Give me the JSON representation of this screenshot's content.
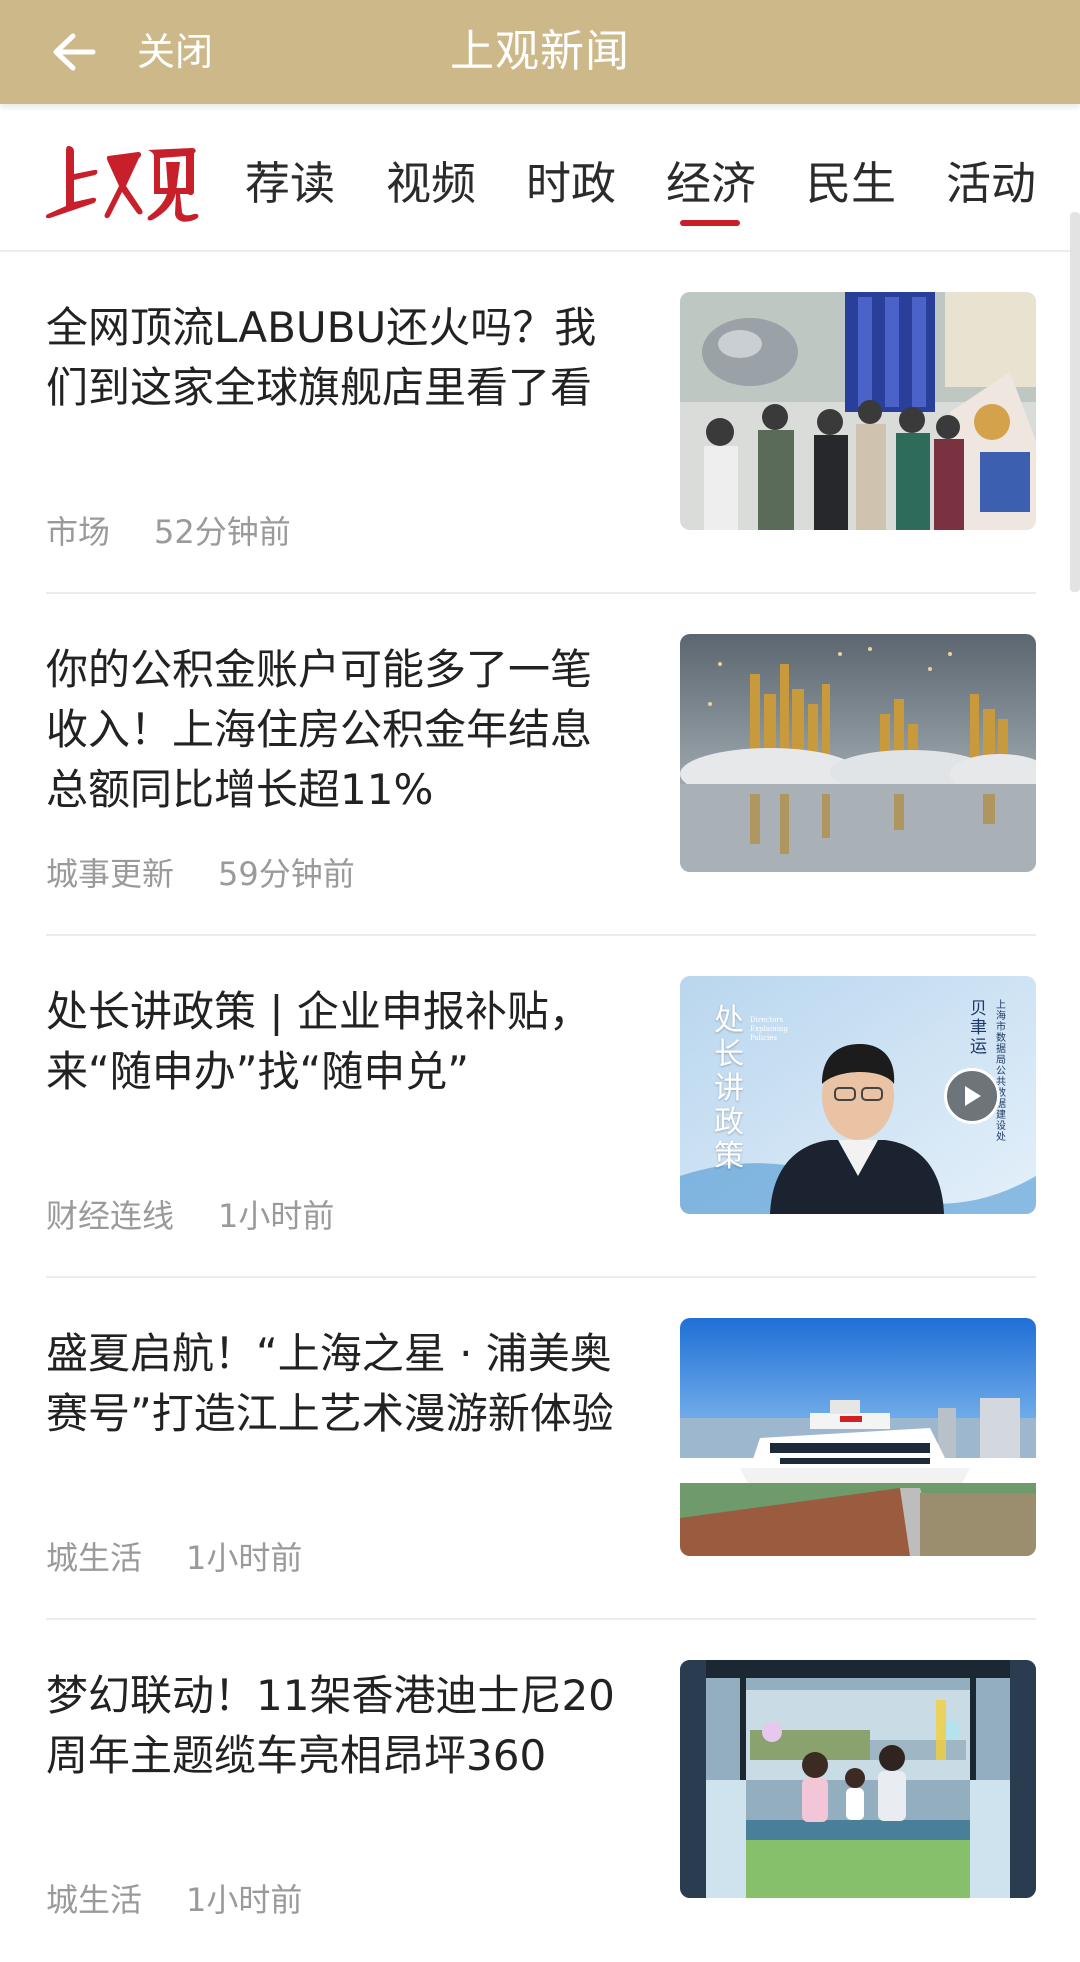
{
  "header": {
    "back_icon": "arrow-left-icon",
    "close_label": "关闭",
    "title": "上观新闻",
    "background_color": "#cdb889"
  },
  "tabs": {
    "brand": "上观",
    "brand_color": "#c8202a",
    "items": [
      {
        "label": "荐读"
      },
      {
        "label": "视频"
      },
      {
        "label": "时政"
      },
      {
        "label": "经济",
        "active": true
      },
      {
        "label": "民生"
      },
      {
        "label": "活动"
      }
    ],
    "active_index": 3
  },
  "news": [
    {
      "title": "全网顶流LABUBU还火吗？我们到这家全球旗舰店里看了看",
      "source": "市场",
      "time": "52分钟前",
      "thumb": "store-crowd-image"
    },
    {
      "title": "你的公积金账户可能多了一笔收入！上海住房公积金年结息总额同比增长超11%",
      "source": "城事更新",
      "time": "59分钟前",
      "thumb": "golden-city-image"
    },
    {
      "title": "处长讲政策 | 企业申报补贴，来“随申办”找“随申兑”",
      "source": "财经连线",
      "time": "1小时前",
      "thumb": "policy-video-image",
      "thumb_text_left": "处长讲政策",
      "thumb_text_en": "Directors Explaining Policies",
      "thumb_text_right": "贝聿运",
      "thumb_text_right_sub": "上海市数据局公共数据建设处"
    },
    {
      "title": "盛夏启航！“上海之星 · 浦美奥赛号”打造江上艺术漫游新体验",
      "source": "城生活",
      "time": "1小时前",
      "thumb": "river-cruise-image"
    },
    {
      "title": "梦幻联动！11架香港迪士尼20周年主题缆车亮相昂坪360",
      "source": "城生活",
      "time": "1小时前",
      "thumb": "cable-car-image"
    }
  ]
}
